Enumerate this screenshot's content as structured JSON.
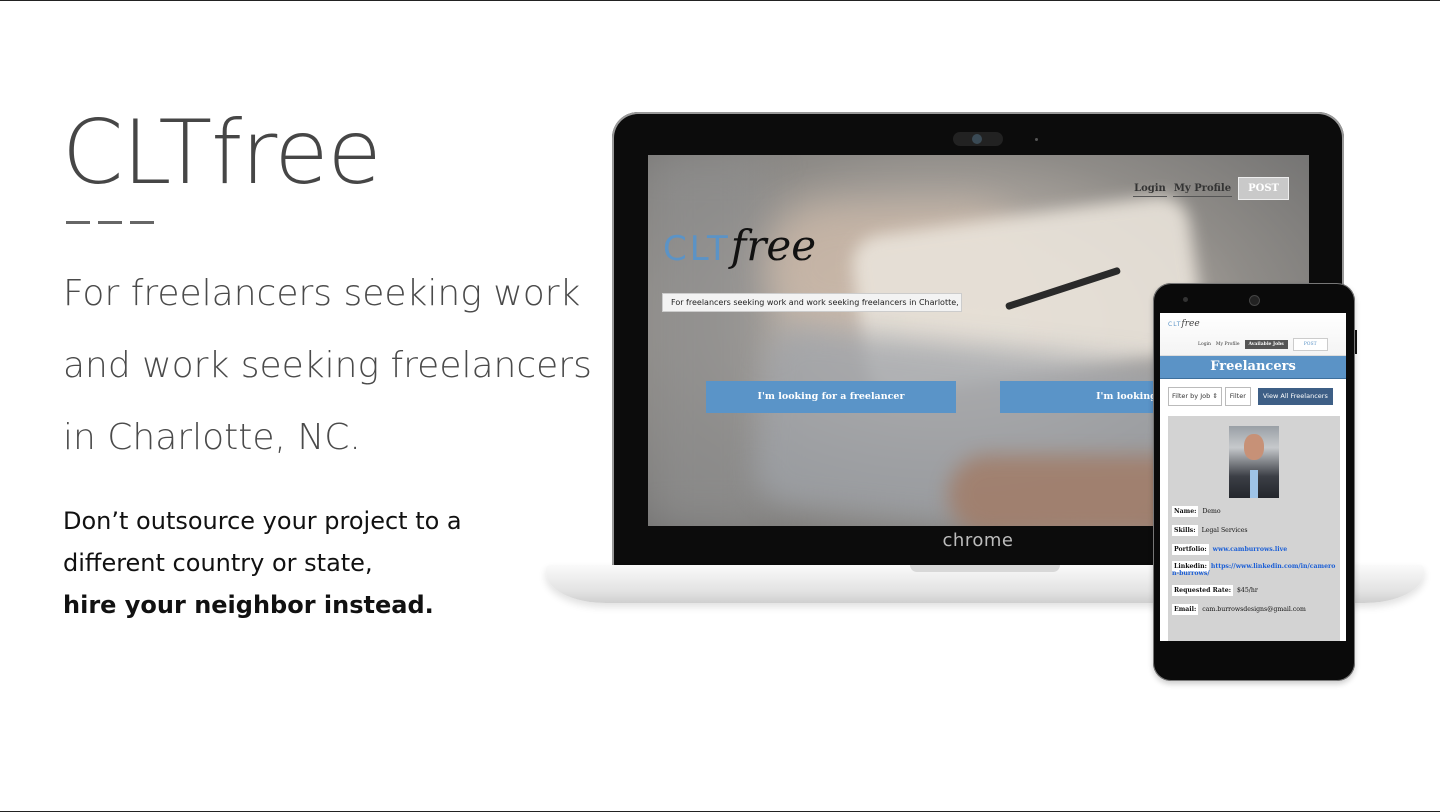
{
  "hero": {
    "title": "CLTfree",
    "tagline_lines": [
      "For freelancers seeking work",
      "and work seeking freelancers",
      "in Charlotte, NC."
    ],
    "pitch_lines": [
      "Don’t outsource your project to a",
      "different country or state,"
    ],
    "pitch_bold": "hire your neighbor instead."
  },
  "laptop": {
    "brand": "chrome",
    "site": {
      "nav": {
        "login": "Login",
        "profile": "My Profile",
        "post": "POST"
      },
      "logo_clt": "CLT",
      "logo_free": "free",
      "subtitle": "For freelancers seeking work and work seeking freelancers in Charlotte, NC.",
      "cta_freelancer": "I'm looking for a freelancer",
      "cta_work": "I'm looking for avail"
    }
  },
  "phone": {
    "logo_clt": "CLT",
    "logo_free": "free",
    "nav": {
      "login": "Login",
      "profile": "My Profile",
      "jobs": "Available Jobs",
      "post": "POST"
    },
    "band": "Freelancers",
    "filter_select": "Filter by Job",
    "filter_button": "Filter",
    "view_all": "View All Freelancers",
    "profile": {
      "name_label": "Name:",
      "name": "Demo",
      "skills_label": "Skills:",
      "skills": "Legal Services",
      "portfolio_label": "Portfolio:",
      "portfolio": "www.camburrows.live",
      "linkedin_label": "Linkedin:",
      "linkedin": "https://www.linkedin.com/in/cameron-burrows/",
      "rate_label": "Requested Rate:",
      "rate": "$45/hr",
      "email_label": "Email:",
      "email": "cam.burrowsdesigns@gmail.com"
    }
  },
  "colors": {
    "accent": "#5b93c6",
    "text": "#464646"
  },
  "icons": [
    "webcam-icon",
    "select-caret-icon"
  ]
}
